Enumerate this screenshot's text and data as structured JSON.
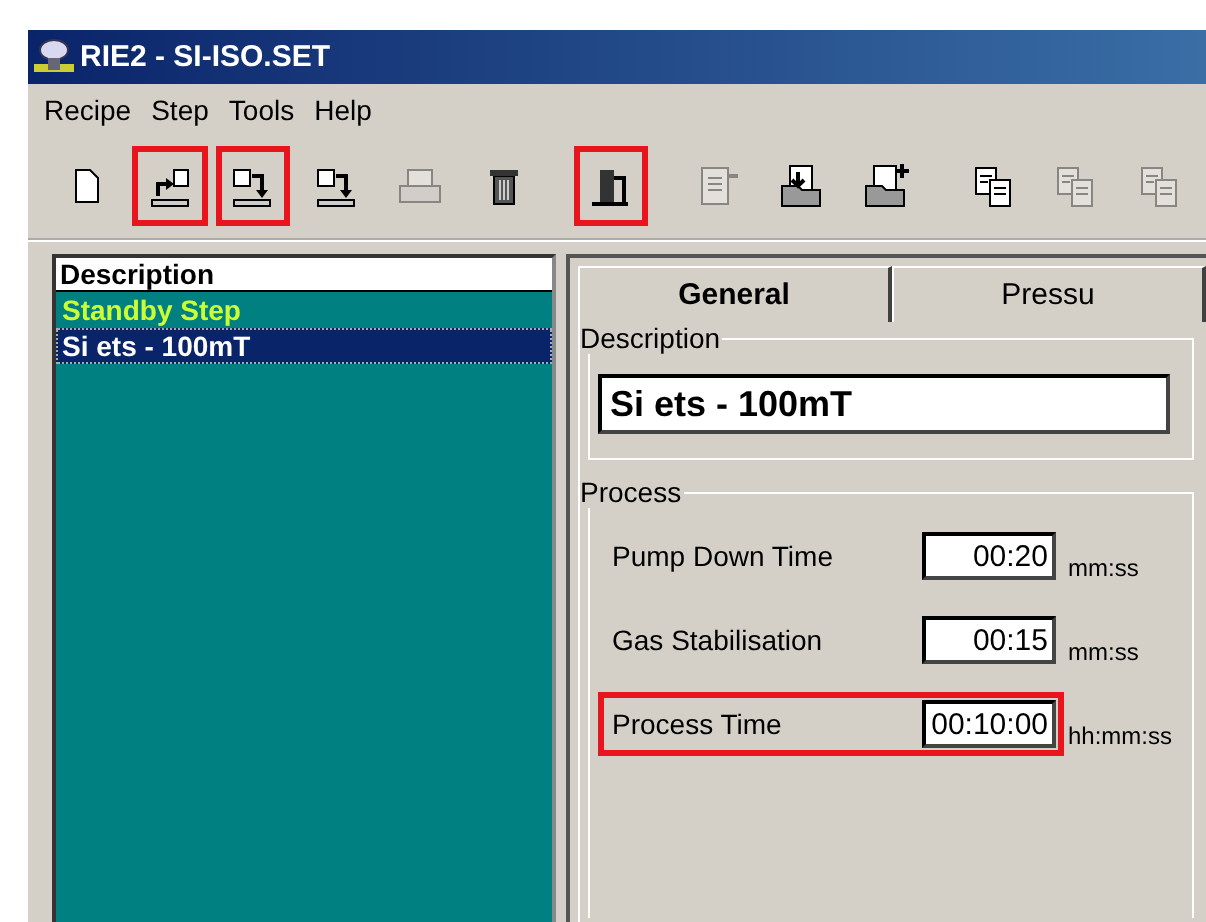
{
  "window": {
    "title": "RIE2 - SI-ISO.SET"
  },
  "menu": [
    "Recipe",
    "Step",
    "Tools",
    "Help"
  ],
  "toolbar": [
    {
      "kind": "new",
      "disabled": false,
      "highlighted": false,
      "group_start": false
    },
    {
      "kind": "export",
      "disabled": false,
      "highlighted": true,
      "group_start": false
    },
    {
      "kind": "import",
      "disabled": false,
      "highlighted": true,
      "group_start": false
    },
    {
      "kind": "import",
      "disabled": false,
      "highlighted": false,
      "group_start": false
    },
    {
      "kind": "print",
      "disabled": true,
      "highlighted": false,
      "group_start": false
    },
    {
      "kind": "trash",
      "disabled": false,
      "highlighted": false,
      "group_start": false
    },
    {
      "kind": "pump",
      "disabled": false,
      "highlighted": true,
      "group_start": true
    },
    {
      "kind": "document",
      "disabled": true,
      "highlighted": false,
      "group_start": true
    },
    {
      "kind": "folder-down",
      "disabled": false,
      "highlighted": false,
      "group_start": false
    },
    {
      "kind": "folder-plus",
      "disabled": false,
      "highlighted": false,
      "group_start": false
    },
    {
      "kind": "copy",
      "disabled": false,
      "highlighted": false,
      "group_start": true
    },
    {
      "kind": "copy",
      "disabled": true,
      "highlighted": false,
      "group_start": false
    },
    {
      "kind": "copy",
      "disabled": true,
      "highlighted": false,
      "group_start": false
    }
  ],
  "steps": {
    "header": "Description",
    "items": [
      {
        "label": "Standby Step",
        "color": "#ccff33",
        "selected": false
      },
      {
        "label": "Si ets - 100mT",
        "color": "#ffffff",
        "selected": true
      }
    ]
  },
  "tabs": [
    {
      "label": "General",
      "selected": true
    },
    {
      "label": "Pressu",
      "selected": false
    }
  ],
  "description": {
    "legend": "Description",
    "value": "Si ets - 100mT"
  },
  "process": {
    "legend": "Process",
    "rows": [
      {
        "label": "Pump Down Time",
        "value": "00:20",
        "unit": "mm:ss",
        "highlighted": false
      },
      {
        "label": "Gas Stabilisation",
        "value": "00:15",
        "unit": "mm:ss",
        "highlighted": false
      },
      {
        "label": "Process Time",
        "value": "00:10:00",
        "unit": "hh:mm:ss",
        "highlighted": true
      }
    ]
  }
}
